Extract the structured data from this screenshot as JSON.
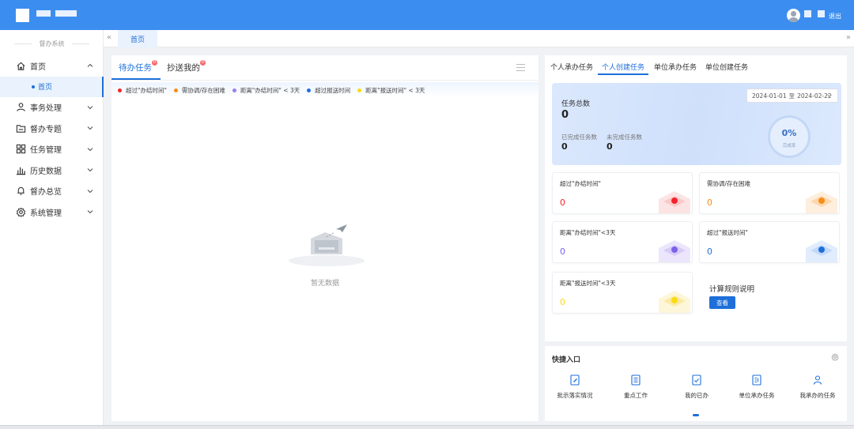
{
  "header": {
    "logout_label": "退出"
  },
  "sidebar": {
    "system_title": "督办系统",
    "items": [
      {
        "label": "首页",
        "icon": "home-icon",
        "expanded": true
      },
      {
        "label": "事务处理",
        "icon": "user-icon"
      },
      {
        "label": "督办专题",
        "icon": "folder-icon"
      },
      {
        "label": "任务管理",
        "icon": "grid-icon"
      },
      {
        "label": "历史数据",
        "icon": "bar-chart-icon"
      },
      {
        "label": "督办总览",
        "icon": "bell-icon"
      },
      {
        "label": "系统管理",
        "icon": "gear-icon"
      }
    ],
    "sub_home": "首页"
  },
  "tabbar": {
    "home_tab": "首页"
  },
  "left_panel": {
    "tabs": [
      {
        "label": "待办任务",
        "badge": "0"
      },
      {
        "label": "抄送我的",
        "badge": "0"
      }
    ],
    "legend": [
      {
        "label": "超过\"办结时间\"",
        "color": "#f5222d"
      },
      {
        "label": "需协调/存在困难",
        "color": "#fa8c16"
      },
      {
        "label": "距离\"办结时间\" < 3天",
        "color": "#9b7df0"
      },
      {
        "label": "超过报送时间",
        "color": "#1e6fd9"
      },
      {
        "label": "距离\"报送时间\" < 3天",
        "color": "#fadb14"
      }
    ],
    "empty_text": "暂无数据"
  },
  "right_panel": {
    "tabs": [
      "个人承办任务",
      "个人创建任务",
      "单位承办任务",
      "单位创建任务"
    ],
    "active_tab": "个人创建任务",
    "summary": {
      "total_label": "任务总数",
      "total": "0",
      "done_label": "已完成任务数",
      "done": "0",
      "todo_label": "未完成任务数",
      "todo": "0",
      "date_start": "2024-01-01",
      "date_sep": "至",
      "date_end": "2024-02-22",
      "rate": "0%",
      "rate_label": "完成率"
    },
    "cards": [
      {
        "title": "超过\"办结时间\"",
        "value": "0",
        "color": "#f5222d"
      },
      {
        "title": "需协调/存在困难",
        "value": "0",
        "color": "#fa8c16"
      },
      {
        "title": "距离\"办结时间\"<3天",
        "value": "0",
        "color": "#7b61e8"
      },
      {
        "title": "超过\"报送时间\"",
        "value": "0",
        "color": "#1e6fd9"
      },
      {
        "title": "距离\"报送时间\"<3天",
        "value": "0",
        "color": "#fadb14"
      }
    ],
    "rule_title": "计算规则说明",
    "rule_button": "查看"
  },
  "quick": {
    "title": "快捷入口",
    "items": [
      {
        "label": "批示落实情况",
        "icon": "edit-doc-icon"
      },
      {
        "label": "重点工作",
        "icon": "doc-list-icon"
      },
      {
        "label": "我的已办",
        "icon": "doc-check-icon"
      },
      {
        "label": "单位承办任务",
        "icon": "doc-grid-icon"
      },
      {
        "label": "我承办的任务",
        "icon": "person-icon"
      }
    ]
  }
}
